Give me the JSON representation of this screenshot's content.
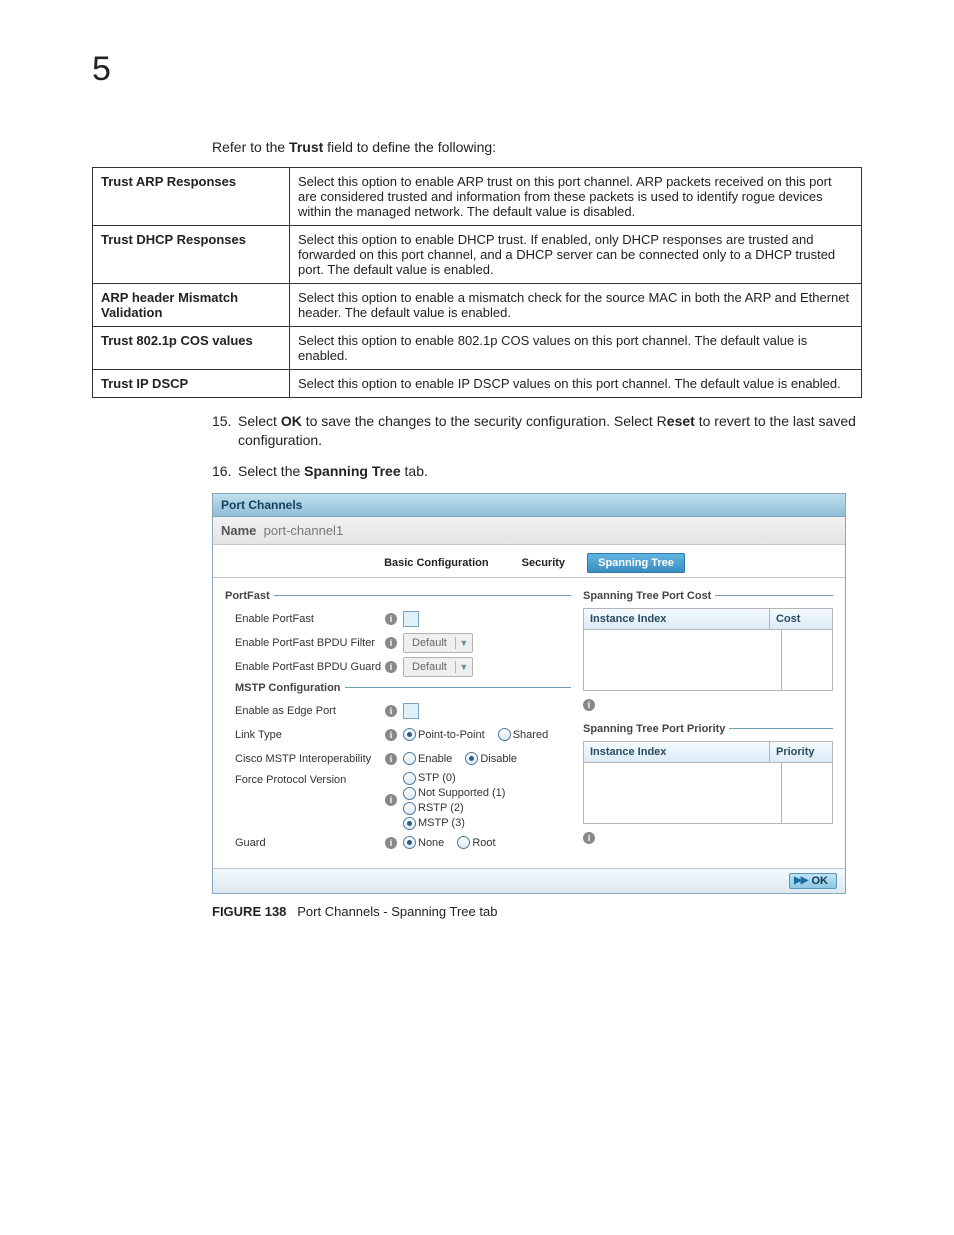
{
  "chapter_number": "5",
  "intro": {
    "pre": "Refer to the ",
    "bold": "Trust",
    "post": " field to define the following:"
  },
  "trust_table": [
    {
      "label": "Trust ARP Responses",
      "desc": "Select this option to enable ARP trust on this port channel. ARP packets received on this port are considered trusted and information from these packets is used to identify rogue devices within the managed network. The default value is disabled."
    },
    {
      "label": "Trust DHCP Responses",
      "desc": "Select this option to enable DHCP trust. If enabled, only DHCP responses are trusted and forwarded on this port channel, and a DHCP server can be connected only to a DHCP trusted port. The default value is enabled."
    },
    {
      "label": "ARP header Mismatch Validation",
      "desc": "Select this option to enable a mismatch check for the source MAC in both the ARP and Ethernet header. The default value is enabled."
    },
    {
      "label": "Trust 802.1p COS values",
      "desc": "Select this option to enable 802.1p COS values on this port channel. The default value is enabled."
    },
    {
      "label": "Trust IP DSCP",
      "desc": "Select this option to enable IP DSCP values on this port channel. The default value is enabled."
    }
  ],
  "steps": {
    "s15": {
      "num": "15.",
      "t1": "Select ",
      "b1": "OK",
      "t2": " to save the changes to the security configuration. Select R",
      "b2": "eset",
      "t3": " to revert to the last saved configuration."
    },
    "s16": {
      "num": "16.",
      "t1": "Select the ",
      "b1": "Spanning Tree",
      "t2": " tab."
    }
  },
  "panel": {
    "title": "Port Channels",
    "name_label": "Name",
    "name_value": "port-channel1",
    "tabs": {
      "basic": "Basic Configuration",
      "security": "Security",
      "spanning": "Spanning Tree"
    },
    "portfast": {
      "head": "PortFast",
      "enable": "Enable PortFast",
      "bpdu_filter": "Enable PortFast BPDU Filter",
      "bpdu_guard": "Enable PortFast BPDU Guard",
      "default": "Default"
    },
    "mstp": {
      "head": "MSTP Configuration",
      "edge": "Enable as Edge Port",
      "link_type": "Link Type",
      "lt_ptp": "Point-to-Point",
      "lt_shared": "Shared",
      "cisco": "Cisco MSTP Interoperability",
      "c_enable": "Enable",
      "c_disable": "Disable",
      "force": "Force Protocol Version",
      "fv_stp": "STP (0)",
      "fv_ns": "Not Supported (1)",
      "fv_rstp": "RSTP (2)",
      "fv_mstp": "MSTP (3)",
      "guard": "Guard",
      "g_none": "None",
      "g_root": "Root"
    },
    "cost": {
      "head": "Spanning Tree Port Cost",
      "col1": "Instance Index",
      "col2": "Cost"
    },
    "prio": {
      "head": "Spanning Tree Port Priority",
      "col1": "Instance Index",
      "col2": "Priority"
    },
    "ok": "OK"
  },
  "figure": {
    "num": "FIGURE 138",
    "caption": "Port Channels - Spanning Tree tab"
  }
}
